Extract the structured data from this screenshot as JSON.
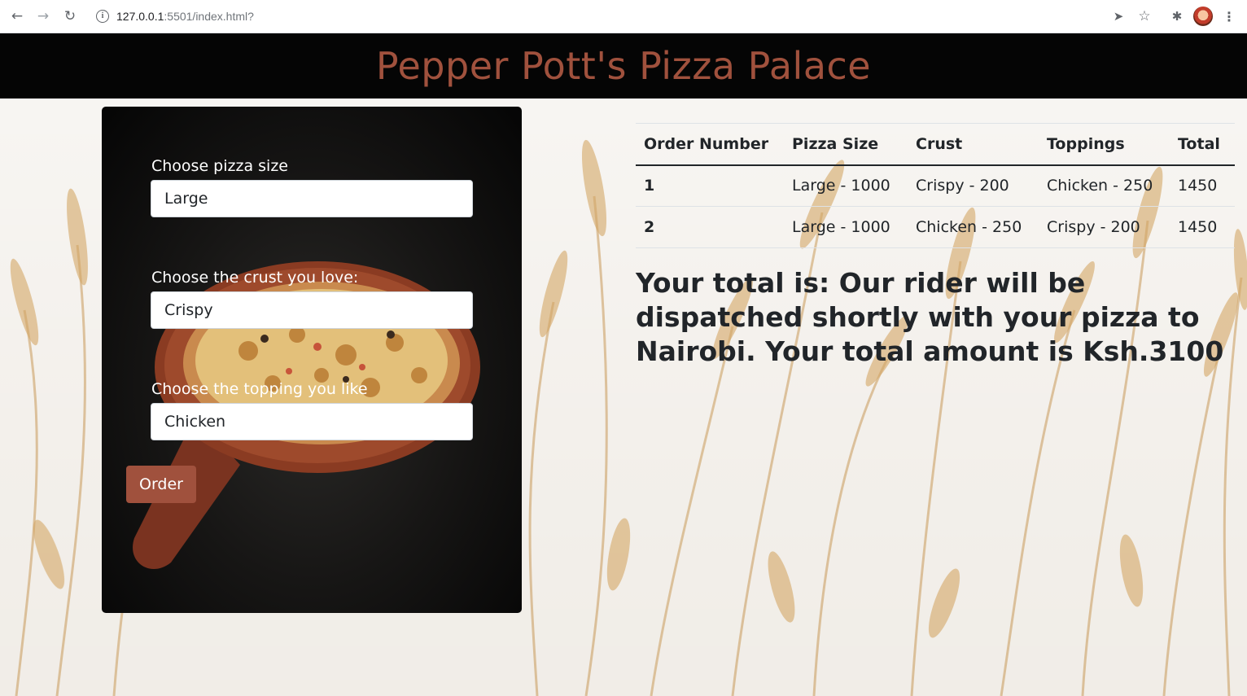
{
  "browser": {
    "url_host": "127.0.0.1",
    "url_rest": ":5501/index.html?"
  },
  "header": {
    "title": "Pepper Pott's Pizza Palace"
  },
  "form": {
    "size_label": "Choose pizza size",
    "size_value": "Large",
    "crust_label": "Choose the crust you love:",
    "crust_value": "Crispy",
    "topping_label": "Choose the topping you like",
    "topping_value": "Chicken",
    "order_button": "Order"
  },
  "table": {
    "headers": [
      "Order Number",
      "Pizza Size",
      "Crust",
      "Toppings",
      "Total"
    ],
    "rows": [
      [
        "1",
        "Large - 1000",
        "Crispy - 200",
        "Chicken - 250",
        "1450"
      ],
      [
        "2",
        "Large - 1000",
        "Chicken - 250",
        "Crispy - 200",
        "1450"
      ]
    ]
  },
  "summary": {
    "text": "Your total is: Our rider will be dispatched shortly with your pizza to Nairobi. Your total amount is Ksh.3100"
  },
  "colors": {
    "brand": "#a0513d",
    "header_bg": "#050505"
  }
}
